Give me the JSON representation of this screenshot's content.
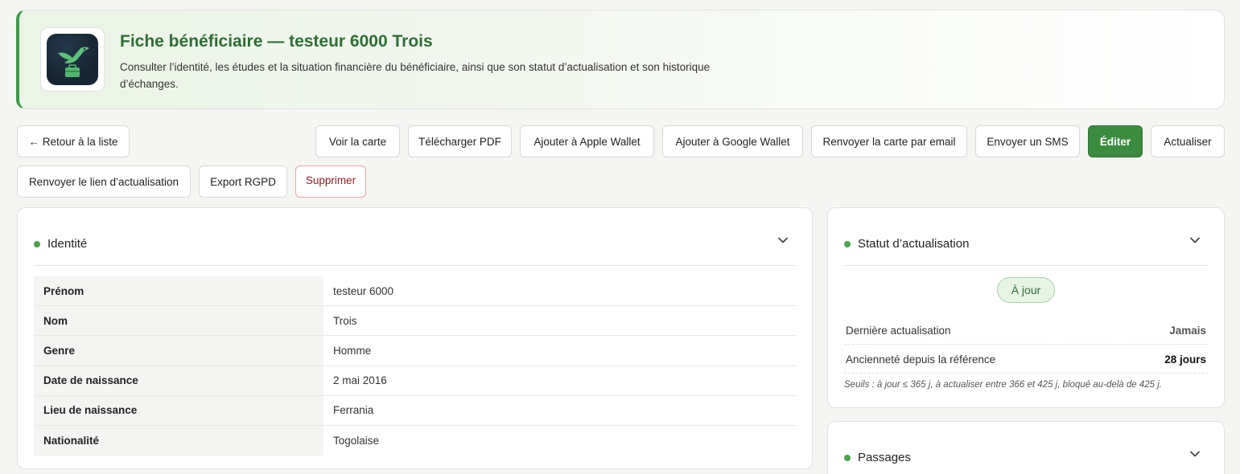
{
  "header": {
    "title": "Fiche bénéficiaire — testeur 6000 Trois",
    "description": "Consulter l’identité, les études et la situation financière du bénéficiaire, ainsi que son statut d’actualisation et son historique d’échanges.",
    "logo_icon": "hummingbird-briefcase-logo"
  },
  "actions": {
    "back": "← Retour à la liste",
    "view_card": "Voir la carte",
    "download_pdf": "Télécharger PDF",
    "apple_wallet": "Ajouter à Apple Wallet",
    "google_wallet": "Ajouter à Google Wallet",
    "resend_card_email": "Renvoyer la carte par email",
    "send_sms": "Envoyer un SMS",
    "edit": "Éditer",
    "refresh": "Actualiser",
    "resend_update_link": "Renvoyer le lien d’actualisation",
    "export_gdpr": "Export RGPD",
    "delete": "Supprimer"
  },
  "identity": {
    "title": "Identité",
    "rows": [
      {
        "label": "Prénom",
        "value": "testeur 6000"
      },
      {
        "label": "Nom",
        "value": "Trois"
      },
      {
        "label": "Genre",
        "value": "Homme"
      },
      {
        "label": "Date de naissance",
        "value": "2 mai 2016"
      },
      {
        "label": "Lieu de naissance",
        "value": "Ferrania"
      },
      {
        "label": "Nationalité",
        "value": "Togolaise"
      }
    ]
  },
  "status": {
    "title": "Statut d’actualisation",
    "badge": "À jour",
    "last_update_label": "Dernière actualisation",
    "last_update_value": "Jamais",
    "seniority_label": "Ancienneté depuis la référence",
    "seniority_value": "28 jours",
    "note": "Seuils : à jour ≤ 365 j, à actualiser entre 366 et 425 j, bloqué au-delà de 425 j."
  },
  "passages": {
    "title": "Passages"
  },
  "colors": {
    "accent": "#3f9a4a",
    "primary_button": "#3c8c3f",
    "title_green": "#2f6e36",
    "danger": "#8a1f1f"
  }
}
